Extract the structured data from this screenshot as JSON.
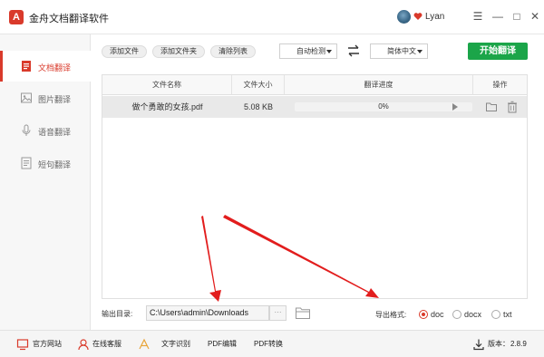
{
  "app": {
    "title": "金舟文档翻译软件",
    "logo_char": "A",
    "user_name": "Lyan",
    "brand_color": "#d93a2b",
    "accent_green": "#1ba549"
  },
  "window_controls": {
    "menu": "☰",
    "minimize": "—",
    "maximize": "□",
    "close": "✕"
  },
  "sidebar": {
    "items": [
      {
        "label": "文档翻译",
        "icon": "document-icon",
        "active": true
      },
      {
        "label": "图片翻译",
        "icon": "image-icon",
        "active": false
      },
      {
        "label": "语音翻译",
        "icon": "microphone-icon",
        "active": false
      },
      {
        "label": "短句翻译",
        "icon": "text-icon",
        "active": false
      }
    ]
  },
  "toolbar": {
    "add_file": "添加文件",
    "add_folder": "添加文件夹",
    "clear_list": "清除列表",
    "source_lang": "自动检测",
    "target_lang": "简体中文",
    "start": "开始翻译"
  },
  "table": {
    "columns": [
      "文件名称",
      "文件大小",
      "翻译进度",
      "操作"
    ],
    "rows": [
      {
        "name": "做个勇敢的女孩.pdf",
        "size": "5.08 KB",
        "progress": 0,
        "progress_text": "0%"
      }
    ]
  },
  "output": {
    "label": "输出目录:",
    "path": "C:\\Users\\admin\\Downloads",
    "browse": "···",
    "format_label": "导出格式:",
    "formats": [
      "doc",
      "docx",
      "txt"
    ],
    "selected_format": "doc"
  },
  "statusbar": {
    "website": "官方网站",
    "online_service": "在线客服",
    "ocr": "文字识别",
    "pdf_edit": "PDF编辑",
    "pdf_convert": "PDF转换",
    "version_label": "版本：",
    "version": "2.8.9"
  }
}
